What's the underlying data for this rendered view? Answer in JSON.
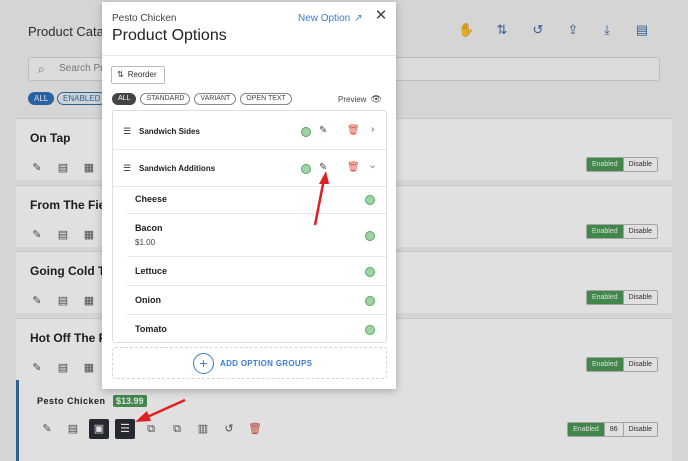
{
  "background": {
    "page_title": "Product Catalog",
    "search_placeholder": "Search Pro",
    "filters": [
      "ALL",
      "ENABLED"
    ],
    "sections": [
      {
        "title": "On Tap",
        "enabled": "Enabled",
        "disable": "Disable"
      },
      {
        "title": "From The Fie",
        "enabled": "Enabled",
        "disable": "Disable"
      },
      {
        "title": "Going Cold T",
        "enabled": "Enabled",
        "disable": "Disable"
      },
      {
        "title": "Hot Off The F",
        "enabled": "Enabled",
        "disable": "Disable"
      }
    ],
    "product": {
      "name": "Pesto Chicken",
      "price": "$13.99",
      "enabled": "Enabled",
      "count": "86",
      "disable": "Disable"
    }
  },
  "modal": {
    "subtitle": "Pesto Chicken",
    "title": "Product Options",
    "new_option": "New Option",
    "close_icon": "close-icon",
    "reorder_label": "Reorder",
    "chips": [
      "ALL",
      "STANDARD",
      "VARIANT",
      "OPEN TEXT"
    ],
    "preview_label": "Preview",
    "groups": [
      {
        "name": "Sandwich Sides",
        "expanded": false
      },
      {
        "name": "Sandwich Additions",
        "expanded": true
      }
    ],
    "items": [
      {
        "name": "Cheese",
        "price": ""
      },
      {
        "name": "Bacon",
        "price": "$1.00"
      },
      {
        "name": "Lettuce",
        "price": ""
      },
      {
        "name": "Onion",
        "price": ""
      },
      {
        "name": "Tomato",
        "price": ""
      }
    ],
    "add_groups_label": "ADD OPTION GROUPS"
  },
  "colors": {
    "accent_blue": "#3a7bd5",
    "status_green": "#9fd4a4",
    "delete_red": "#d84a3a",
    "enabled_green": "#4a9a57",
    "annotation_red": "#e02020"
  }
}
